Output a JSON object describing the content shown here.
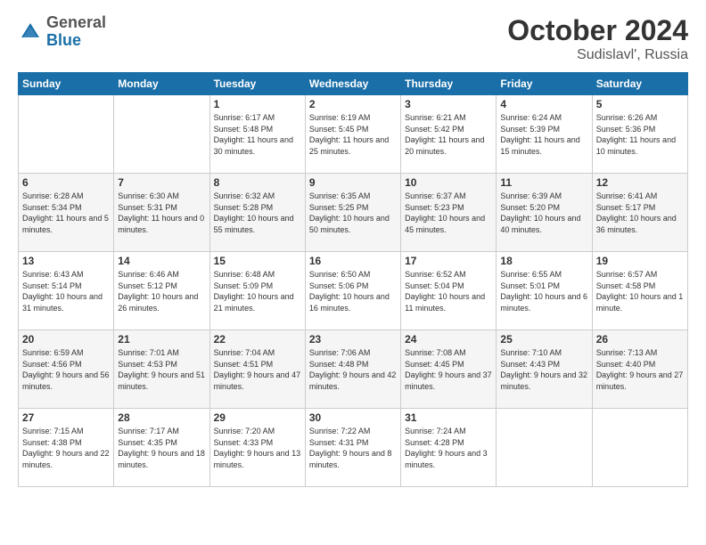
{
  "header": {
    "logo_line1": "General",
    "logo_line2": "Blue",
    "title": "October 2024",
    "subtitle": "Sudislavl', Russia"
  },
  "days_of_week": [
    "Sunday",
    "Monday",
    "Tuesday",
    "Wednesday",
    "Thursday",
    "Friday",
    "Saturday"
  ],
  "weeks": [
    [
      {
        "day": "",
        "info": ""
      },
      {
        "day": "",
        "info": ""
      },
      {
        "day": "1",
        "info": "Sunrise: 6:17 AM\nSunset: 5:48 PM\nDaylight: 11 hours and 30 minutes."
      },
      {
        "day": "2",
        "info": "Sunrise: 6:19 AM\nSunset: 5:45 PM\nDaylight: 11 hours and 25 minutes."
      },
      {
        "day": "3",
        "info": "Sunrise: 6:21 AM\nSunset: 5:42 PM\nDaylight: 11 hours and 20 minutes."
      },
      {
        "day": "4",
        "info": "Sunrise: 6:24 AM\nSunset: 5:39 PM\nDaylight: 11 hours and 15 minutes."
      },
      {
        "day": "5",
        "info": "Sunrise: 6:26 AM\nSunset: 5:36 PM\nDaylight: 11 hours and 10 minutes."
      }
    ],
    [
      {
        "day": "6",
        "info": "Sunrise: 6:28 AM\nSunset: 5:34 PM\nDaylight: 11 hours and 5 minutes."
      },
      {
        "day": "7",
        "info": "Sunrise: 6:30 AM\nSunset: 5:31 PM\nDaylight: 11 hours and 0 minutes."
      },
      {
        "day": "8",
        "info": "Sunrise: 6:32 AM\nSunset: 5:28 PM\nDaylight: 10 hours and 55 minutes."
      },
      {
        "day": "9",
        "info": "Sunrise: 6:35 AM\nSunset: 5:25 PM\nDaylight: 10 hours and 50 minutes."
      },
      {
        "day": "10",
        "info": "Sunrise: 6:37 AM\nSunset: 5:23 PM\nDaylight: 10 hours and 45 minutes."
      },
      {
        "day": "11",
        "info": "Sunrise: 6:39 AM\nSunset: 5:20 PM\nDaylight: 10 hours and 40 minutes."
      },
      {
        "day": "12",
        "info": "Sunrise: 6:41 AM\nSunset: 5:17 PM\nDaylight: 10 hours and 36 minutes."
      }
    ],
    [
      {
        "day": "13",
        "info": "Sunrise: 6:43 AM\nSunset: 5:14 PM\nDaylight: 10 hours and 31 minutes."
      },
      {
        "day": "14",
        "info": "Sunrise: 6:46 AM\nSunset: 5:12 PM\nDaylight: 10 hours and 26 minutes."
      },
      {
        "day": "15",
        "info": "Sunrise: 6:48 AM\nSunset: 5:09 PM\nDaylight: 10 hours and 21 minutes."
      },
      {
        "day": "16",
        "info": "Sunrise: 6:50 AM\nSunset: 5:06 PM\nDaylight: 10 hours and 16 minutes."
      },
      {
        "day": "17",
        "info": "Sunrise: 6:52 AM\nSunset: 5:04 PM\nDaylight: 10 hours and 11 minutes."
      },
      {
        "day": "18",
        "info": "Sunrise: 6:55 AM\nSunset: 5:01 PM\nDaylight: 10 hours and 6 minutes."
      },
      {
        "day": "19",
        "info": "Sunrise: 6:57 AM\nSunset: 4:58 PM\nDaylight: 10 hours and 1 minute."
      }
    ],
    [
      {
        "day": "20",
        "info": "Sunrise: 6:59 AM\nSunset: 4:56 PM\nDaylight: 9 hours and 56 minutes."
      },
      {
        "day": "21",
        "info": "Sunrise: 7:01 AM\nSunset: 4:53 PM\nDaylight: 9 hours and 51 minutes."
      },
      {
        "day": "22",
        "info": "Sunrise: 7:04 AM\nSunset: 4:51 PM\nDaylight: 9 hours and 47 minutes."
      },
      {
        "day": "23",
        "info": "Sunrise: 7:06 AM\nSunset: 4:48 PM\nDaylight: 9 hours and 42 minutes."
      },
      {
        "day": "24",
        "info": "Sunrise: 7:08 AM\nSunset: 4:45 PM\nDaylight: 9 hours and 37 minutes."
      },
      {
        "day": "25",
        "info": "Sunrise: 7:10 AM\nSunset: 4:43 PM\nDaylight: 9 hours and 32 minutes."
      },
      {
        "day": "26",
        "info": "Sunrise: 7:13 AM\nSunset: 4:40 PM\nDaylight: 9 hours and 27 minutes."
      }
    ],
    [
      {
        "day": "27",
        "info": "Sunrise: 7:15 AM\nSunset: 4:38 PM\nDaylight: 9 hours and 22 minutes."
      },
      {
        "day": "28",
        "info": "Sunrise: 7:17 AM\nSunset: 4:35 PM\nDaylight: 9 hours and 18 minutes."
      },
      {
        "day": "29",
        "info": "Sunrise: 7:20 AM\nSunset: 4:33 PM\nDaylight: 9 hours and 13 minutes."
      },
      {
        "day": "30",
        "info": "Sunrise: 7:22 AM\nSunset: 4:31 PM\nDaylight: 9 hours and 8 minutes."
      },
      {
        "day": "31",
        "info": "Sunrise: 7:24 AM\nSunset: 4:28 PM\nDaylight: 9 hours and 3 minutes."
      },
      {
        "day": "",
        "info": ""
      },
      {
        "day": "",
        "info": ""
      }
    ]
  ]
}
